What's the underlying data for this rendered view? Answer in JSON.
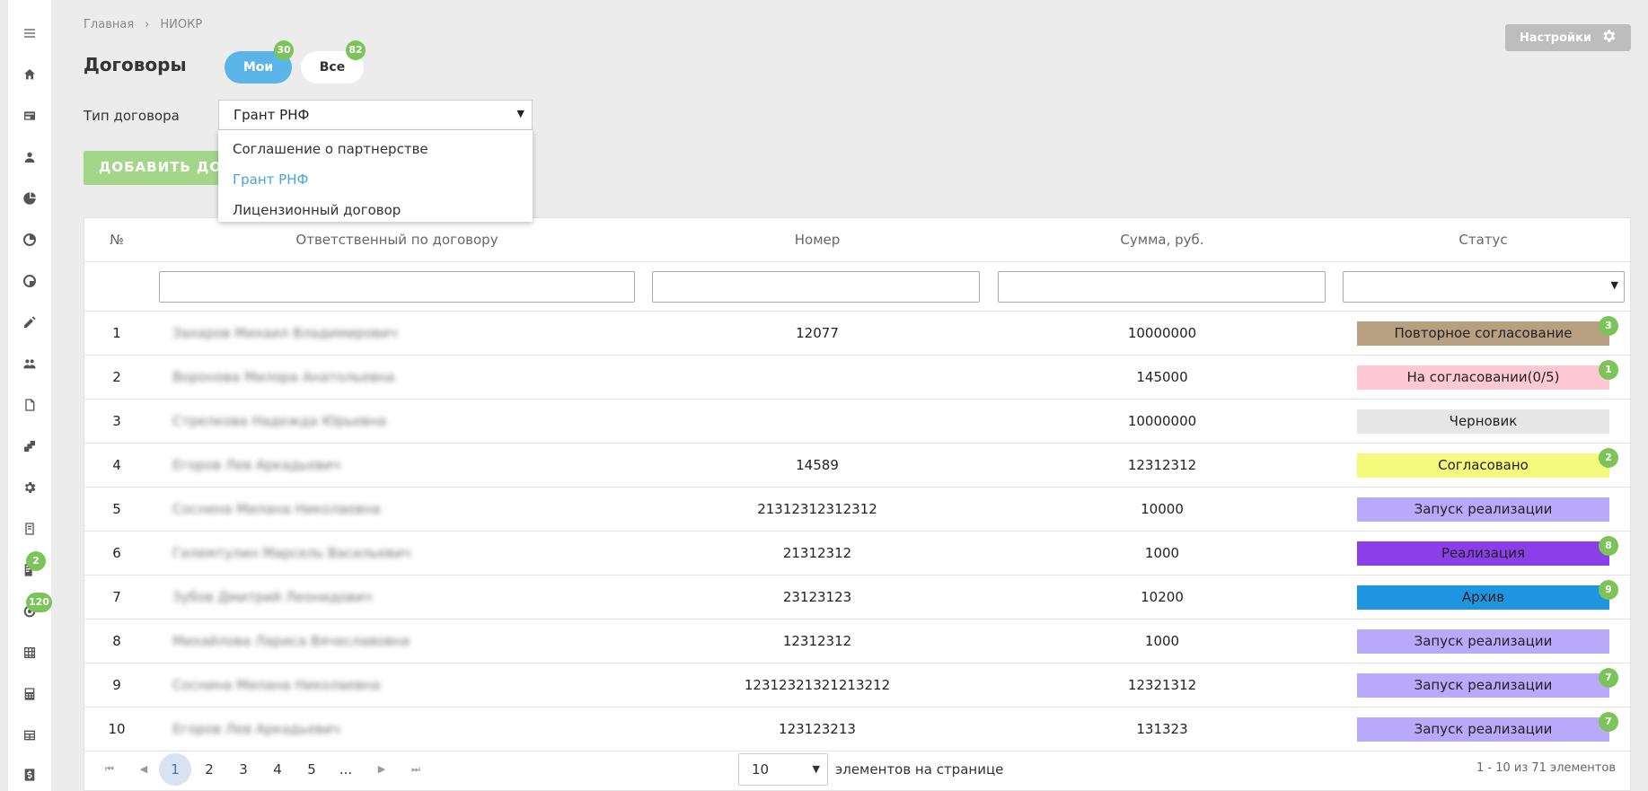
{
  "breadcrumb": {
    "home": "Главная",
    "sep": "›",
    "current": "НИОКР"
  },
  "page": {
    "title": "Договоры"
  },
  "toggle": {
    "my_label": "Мои",
    "my_count": "30",
    "all_label": "Все",
    "all_count": "82"
  },
  "settings": {
    "label": "Настройки",
    "icon": "gear-icon"
  },
  "sidebar": {
    "badges": {
      "item13": "2",
      "item14": "120"
    },
    "icons": [
      "menu-icon",
      "home-icon",
      "card-icon",
      "user-icon",
      "pie-chart-icon",
      "chart-icon",
      "chart-alt-icon",
      "edit-icon",
      "users-icon",
      "document-icon",
      "puzzle-icon",
      "gear-icon",
      "book-icon",
      "contract-icon",
      "circle-icon",
      "grid-icon",
      "calculator-icon",
      "table-icon",
      "dollar-icon"
    ]
  },
  "contract_type": {
    "label": "Тип договора",
    "selected": "Грант РНФ",
    "options": [
      "Соглашение о партнерстве",
      "Грант РНФ",
      "Лицензионный договор"
    ]
  },
  "add_button": {
    "label": "ДОБАВИТЬ ДОКУМЕНТ"
  },
  "table": {
    "headers": {
      "num": "№",
      "responsible": "Ответственный по договору",
      "number": "Номер",
      "sum": "Сумма, руб.",
      "status": "Статус"
    },
    "rows": [
      {
        "num": "1",
        "responsible": "Захаров Михаил Владимирович",
        "number": "12077",
        "sum": "10000000",
        "status": "Повторное согласование",
        "status_color": "#b99f82",
        "badge": "3"
      },
      {
        "num": "2",
        "responsible": "Воронова Милора Анатольевна",
        "number": "",
        "sum": "145000",
        "status": "На согласовании(0/5)",
        "status_color": "#ffc9d3",
        "badge": "1"
      },
      {
        "num": "3",
        "responsible": "Стрелкова Надежда Юрьевна",
        "number": "",
        "sum": "10000000",
        "status": "Черновик",
        "status_color": "#e6e6e6",
        "badge": ""
      },
      {
        "num": "4",
        "responsible": "Егоров Лев Аркадьевич",
        "number": "14589",
        "sum": "12312312",
        "status": "Согласовано",
        "status_color": "#f4fa7c",
        "badge": "2"
      },
      {
        "num": "5",
        "responsible": "Соснина Милана Николаевна",
        "number": "21312312312312",
        "sum": "10000",
        "status": "Запуск реализации",
        "status_color": "#b8a9fa",
        "badge": ""
      },
      {
        "num": "6",
        "responsible": "Гилемтулин Марсель Васильевич",
        "number": "21312312",
        "sum": "1000",
        "status": "Реализация",
        "status_color": "#8a3fe8",
        "badge": "8"
      },
      {
        "num": "7",
        "responsible": "Зубов Дмитрий Леонидович",
        "number": "23123123",
        "sum": "10200",
        "status": "Архив",
        "status_color": "#1f94e0",
        "badge": "9"
      },
      {
        "num": "8",
        "responsible": "Михайлова Лариса Вячеславовна",
        "number": "12312312",
        "sum": "1000",
        "status": "Запуск реализации",
        "status_color": "#b8a9fa",
        "badge": ""
      },
      {
        "num": "9",
        "responsible": "Соснина Милана Николаевна",
        "number": "12312321321213212",
        "sum": "12321312",
        "status": "Запуск реализации",
        "status_color": "#b8a9fa",
        "badge": "7"
      },
      {
        "num": "10",
        "responsible": "Егоров Лев Аркадьевич",
        "number": "123123213",
        "sum": "131323",
        "status": "Запуск реализации",
        "status_color": "#b8a9fa",
        "badge": "7"
      }
    ]
  },
  "pager": {
    "pages": [
      "1",
      "2",
      "3",
      "4",
      "5",
      "..."
    ],
    "current": "1",
    "per_page": "10",
    "per_page_label": "элементов на странице",
    "range": "1 - 10 из 71 элементов"
  }
}
